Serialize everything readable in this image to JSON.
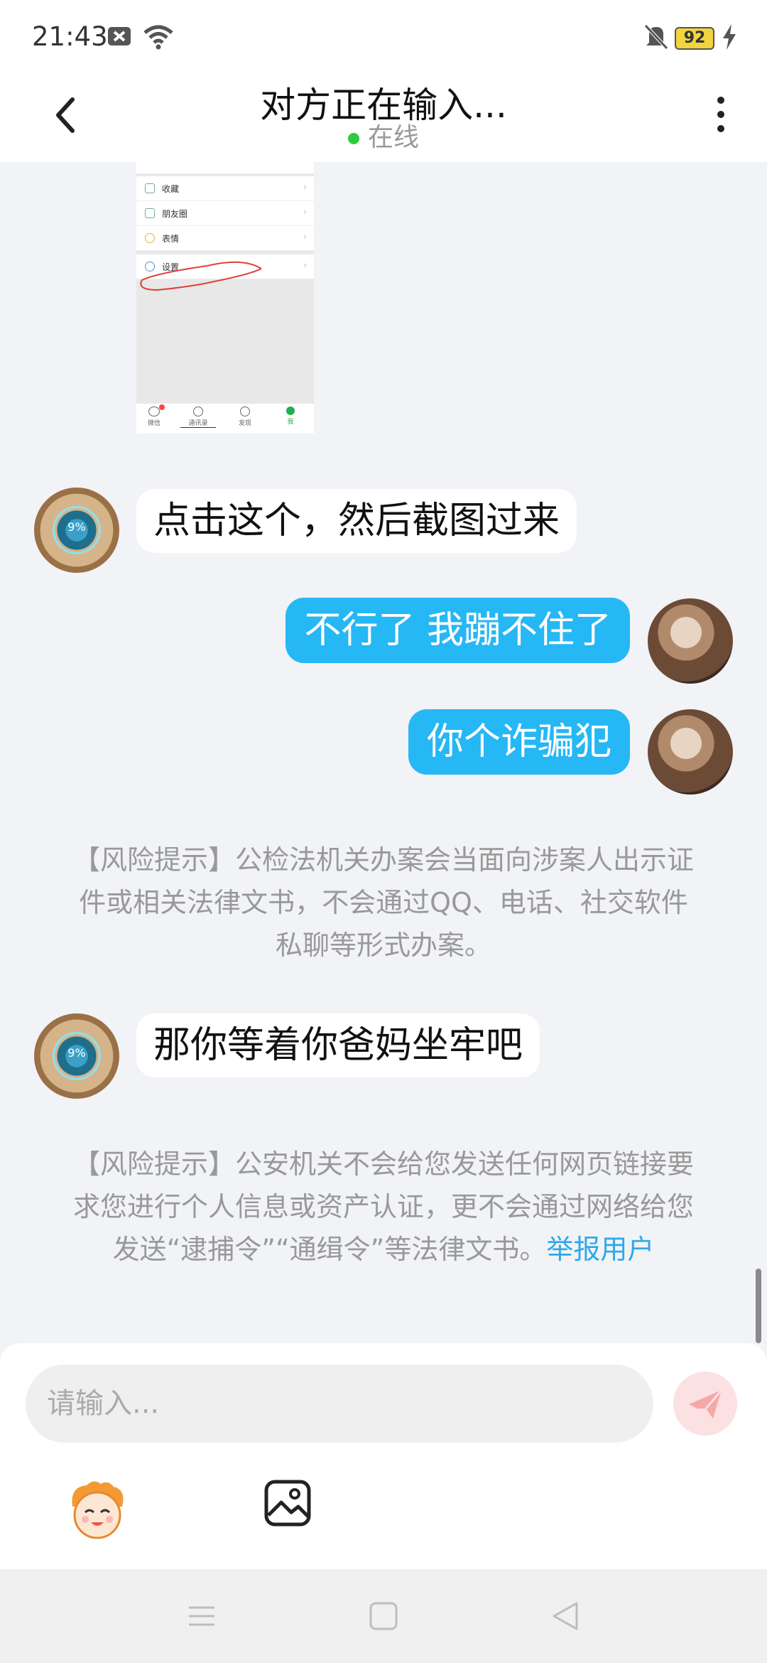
{
  "status_bar": {
    "time": "21:43",
    "battery": "92"
  },
  "header": {
    "title": "对方正在输入...",
    "status": "在线"
  },
  "screenshot_image": {
    "menu_items": [
      "收藏",
      "朋友圈",
      "表情",
      "设置"
    ],
    "tabs": [
      "微信",
      "通讯录",
      "发现",
      "我"
    ]
  },
  "messages": [
    {
      "side": "left",
      "text": "点击这个，然后截图过来",
      "avatar_label": "9%"
    },
    {
      "side": "right",
      "text": "不行了 我蹦不住了"
    },
    {
      "side": "right",
      "text": "你个诈骗犯"
    },
    {
      "side": "left",
      "text": "那你等着你爸妈坐牢吧",
      "avatar_label": "9%"
    }
  ],
  "risk_tips": [
    {
      "text": "【风险提示】公检法机关办案会当面向涉案人出示证件或相关法律文书，不会通过QQ、电话、社交软件私聊等形式办案。"
    },
    {
      "text": "【风险提示】公安机关不会给您发送任何网页链接要求您进行个人信息或资产认证，更不会通过网络给您发送“逮捕令”“通缉令”等法律文书。",
      "link": "举报用户"
    }
  ],
  "input": {
    "placeholder": "请输入..."
  },
  "colors": {
    "outgoing_bubble": "#26b7f5",
    "link": "#2fa8e8",
    "online": "#2ecc40"
  }
}
